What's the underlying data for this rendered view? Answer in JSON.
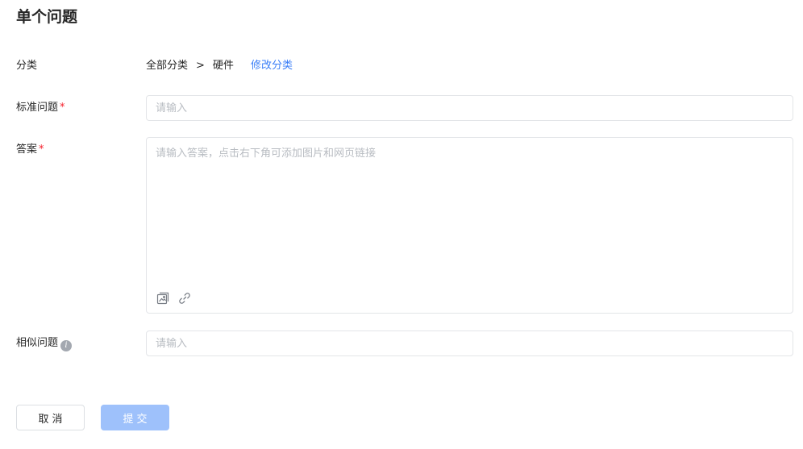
{
  "page_title": "单个问题",
  "category": {
    "label": "分类",
    "path_root": "全部分类",
    "path_separator": ">",
    "path_leaf": "硬件",
    "edit_link": "修改分类"
  },
  "standard_question": {
    "label": "标准问题",
    "required_mark": "*",
    "placeholder": "请输入",
    "value": ""
  },
  "answer": {
    "label": "答案",
    "required_mark": "*",
    "placeholder": "请输入答案，点击右下角可添加图片和网页链接",
    "value": "",
    "tools": [
      "image-icon",
      "link-icon"
    ]
  },
  "similar_question": {
    "label": "相似问题",
    "info_icon": "info-icon",
    "placeholder": "请输入",
    "value": ""
  },
  "actions": {
    "cancel_label": "取消",
    "submit_label": "提交"
  },
  "colors": {
    "link": "#3a7ef7",
    "required": "#f5222d",
    "submit_disabled": "#9ec1fb",
    "border": "#e3e5e8",
    "placeholder": "#b8bcc2"
  }
}
